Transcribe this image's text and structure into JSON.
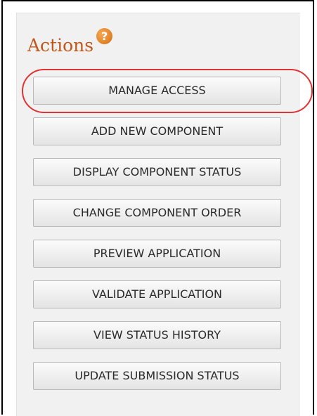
{
  "panel": {
    "heading": "Actions",
    "help_icon": "question-mark-icon",
    "help_glyph": "?",
    "accent_color": "#c0581a",
    "highlight_color": "#e03333"
  },
  "actions": [
    {
      "label": "MANAGE ACCESS"
    },
    {
      "label": "ADD NEW COMPONENT"
    },
    {
      "label": "DISPLAY COMPONENT STATUS"
    },
    {
      "label": "CHANGE COMPONENT ORDER"
    },
    {
      "label": "PREVIEW APPLICATION"
    },
    {
      "label": "VALIDATE APPLICATION"
    },
    {
      "label": "VIEW STATUS HISTORY"
    },
    {
      "label": "UPDATE SUBMISSION STATUS"
    }
  ]
}
